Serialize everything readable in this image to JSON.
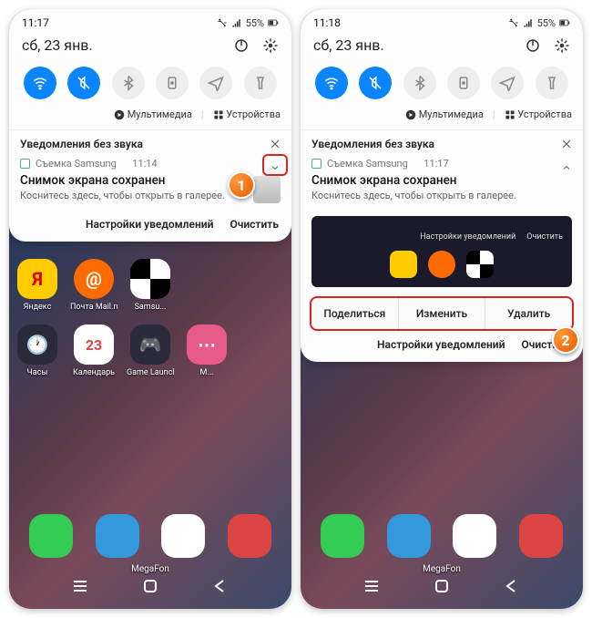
{
  "left": {
    "time": "11:17",
    "battery": "55%",
    "date": "сб, 23 янв.",
    "media": "Мультимедиа",
    "devices": "Устройства",
    "silent_header": "Уведомления без звука",
    "app_name": "Съемка Samsung",
    "notif_time": "11:14",
    "notif_title": "Снимок экрана сохранен",
    "notif_sub": "Коснитесь здесь, чтобы открыть в галерее.",
    "settings_btn": "Настройки уведомлений",
    "clear_btn": "Очистить",
    "callout": "1"
  },
  "right": {
    "time": "11:18",
    "battery": "55%",
    "date": "сб, 23 янв.",
    "media": "Мультимедиа",
    "devices": "Устройства",
    "silent_header": "Уведомления без звука",
    "app_name": "Съемка Samsung",
    "notif_time": "11:17",
    "notif_title": "Снимок экрана сохранен",
    "notif_sub": "Коснитесь здесь, чтобы открыть в галерее.",
    "mini_settings": "Настройки уведомлений",
    "mini_clear": "Очистить",
    "action_share": "Поделиться",
    "action_edit": "Изменить",
    "action_delete": "Удалить",
    "settings_btn": "Настройки уведомлений",
    "clear_btn": "Очистить",
    "callout": "2"
  },
  "apps": {
    "yandex": "Яндекс",
    "mailru": "Почта Mail.ru",
    "samsung": "Samsu...",
    "clock": "Часы",
    "calendar": "Календарь",
    "game": "Game Launcher",
    "more": "M..."
  },
  "calendar_day": "23",
  "carrier": "MegaFon"
}
